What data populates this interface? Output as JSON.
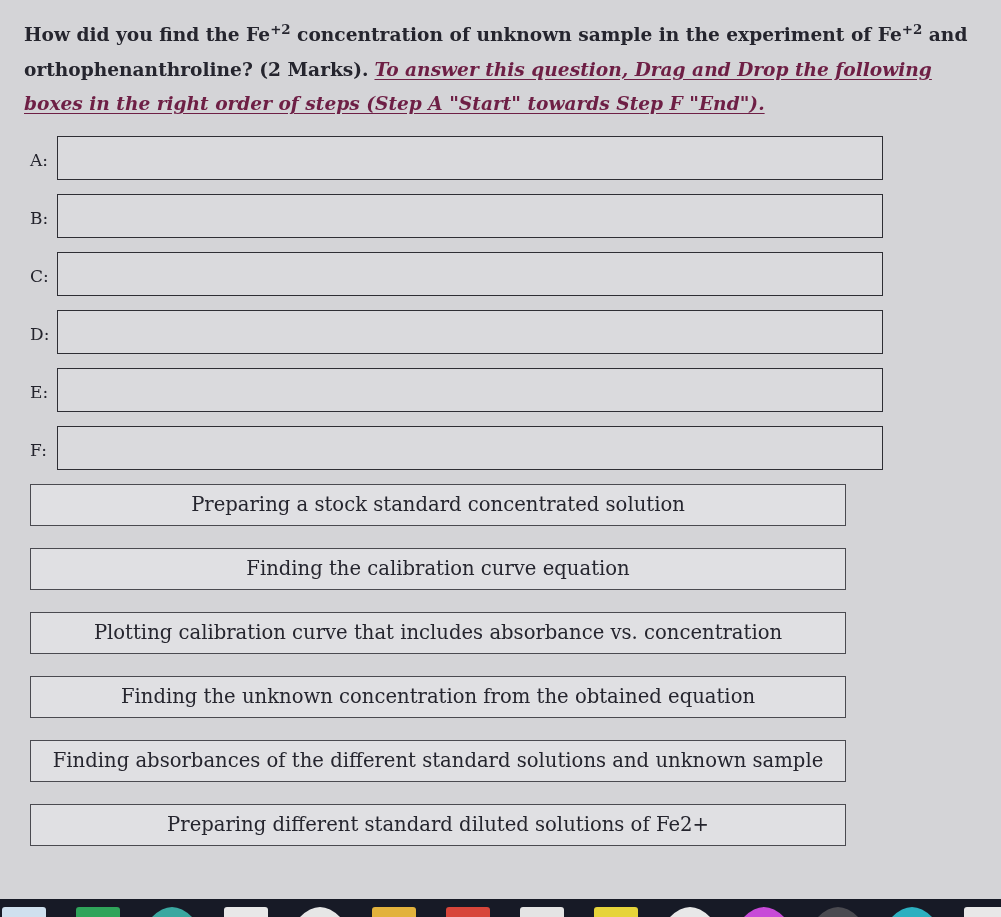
{
  "question": {
    "text": "How did you find the Fe$^{+2}$ concentration of unknown sample in the experiment of Fe$^{+2}$ and orthophenanthroline? (2 Marks).",
    "instruction": "To answer this question, Drag and Drop the following boxes in the right order of steps (Step A \"Start\" towards Step F \"End\")."
  },
  "answer_slots": [
    {
      "label": "A:"
    },
    {
      "label": "B:"
    },
    {
      "label": "C:"
    },
    {
      "label": "D:"
    },
    {
      "label": "E:"
    },
    {
      "label": "F:"
    }
  ],
  "options": [
    {
      "text": "Preparing a stock standard concentrated solution"
    },
    {
      "text": "Finding the calibration curve equation"
    },
    {
      "text": "Plotting calibration curve that includes absorbance vs. concentration"
    },
    {
      "text": "Finding the unknown concentration from the obtained equation"
    },
    {
      "text": "Finding absorbances of the different standard solutions and unknown sample"
    },
    {
      "text": "Preparing different standard diluted solutions of Fe2+"
    }
  ],
  "taskbar": {
    "icons": [
      {
        "kind": "tile",
        "color": "#cfe0ee"
      },
      {
        "kind": "tile",
        "color": "#2fa45a"
      },
      {
        "kind": "circle",
        "color": "#3aa8a0"
      },
      {
        "kind": "tile",
        "color": "#e8e8e8"
      },
      {
        "kind": "circle",
        "color": "#e6e6e6"
      },
      {
        "kind": "tile",
        "color": "#e2b23c"
      },
      {
        "kind": "tile",
        "color": "#d8453a"
      },
      {
        "kind": "tile",
        "color": "#e4e4e4"
      },
      {
        "kind": "tile",
        "color": "#e6d43a"
      },
      {
        "kind": "circle",
        "color": "#e8e8e8"
      },
      {
        "kind": "circle",
        "color": "#c84ad8"
      },
      {
        "kind": "circle",
        "color": "#4a4a50"
      },
      {
        "kind": "circle",
        "color": "#2cb0c0"
      },
      {
        "kind": "tile",
        "color": "#e8e8e8"
      }
    ]
  }
}
